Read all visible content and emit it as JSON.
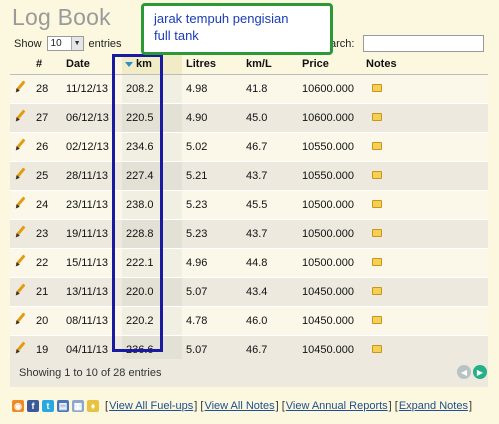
{
  "page": {
    "title": "Log Book"
  },
  "controls": {
    "show_label": "Show",
    "show_value": "10",
    "entries_label": "entries",
    "search_label": "arch:"
  },
  "table": {
    "headers": [
      "#",
      "Date",
      "km",
      "Litres",
      "km/L",
      "Price",
      "Notes"
    ],
    "rows": [
      {
        "id": "28",
        "date": "11/12/13",
        "km": "208.2",
        "litres": "4.98",
        "kml": "41.8",
        "price": "10600.000"
      },
      {
        "id": "27",
        "date": "06/12/13",
        "km": "220.5",
        "litres": "4.90",
        "kml": "45.0",
        "price": "10600.000"
      },
      {
        "id": "26",
        "date": "02/12/13",
        "km": "234.6",
        "litres": "5.02",
        "kml": "46.7",
        "price": "10550.000"
      },
      {
        "id": "25",
        "date": "28/11/13",
        "km": "227.4",
        "litres": "5.21",
        "kml": "43.7",
        "price": "10550.000"
      },
      {
        "id": "24",
        "date": "23/11/13",
        "km": "238.0",
        "litres": "5.23",
        "kml": "45.5",
        "price": "10500.000"
      },
      {
        "id": "23",
        "date": "19/11/13",
        "km": "228.8",
        "litres": "5.23",
        "kml": "43.7",
        "price": "10500.000"
      },
      {
        "id": "22",
        "date": "15/11/13",
        "km": "222.1",
        "litres": "4.96",
        "kml": "44.8",
        "price": "10500.000"
      },
      {
        "id": "21",
        "date": "13/11/13",
        "km": "220.0",
        "litres": "5.07",
        "kml": "43.4",
        "price": "10450.000"
      },
      {
        "id": "20",
        "date": "08/11/13",
        "km": "220.2",
        "litres": "4.78",
        "kml": "46.0",
        "price": "10450.000"
      },
      {
        "id": "19",
        "date": "04/11/13",
        "km": "236.6",
        "litres": "5.07",
        "kml": "46.7",
        "price": "10450.000"
      }
    ]
  },
  "footer": {
    "info": "Showing 1 to 10 of 28 entries",
    "prev_icon": "◀",
    "next_icon": "▶"
  },
  "links": {
    "icons": [
      "rss-icon",
      "facebook-icon",
      "twitter-icon",
      "save-icon",
      "calendar-icon",
      "shield-icon"
    ],
    "items": [
      "View All Fuel-ups",
      "View All Notes",
      "View Annual Reports",
      "Expand Notes"
    ]
  },
  "annotation": {
    "text_line1": "jarak tempuh pengisian",
    "text_line2": "full tank"
  },
  "colors": {
    "background": "#fbf8df",
    "title": "#9a9a9a",
    "highlight_box": "#1a1aa0",
    "callout_border": "#2b9a36",
    "callout_text": "#1a3cb8",
    "next_button": "#26b088"
  }
}
